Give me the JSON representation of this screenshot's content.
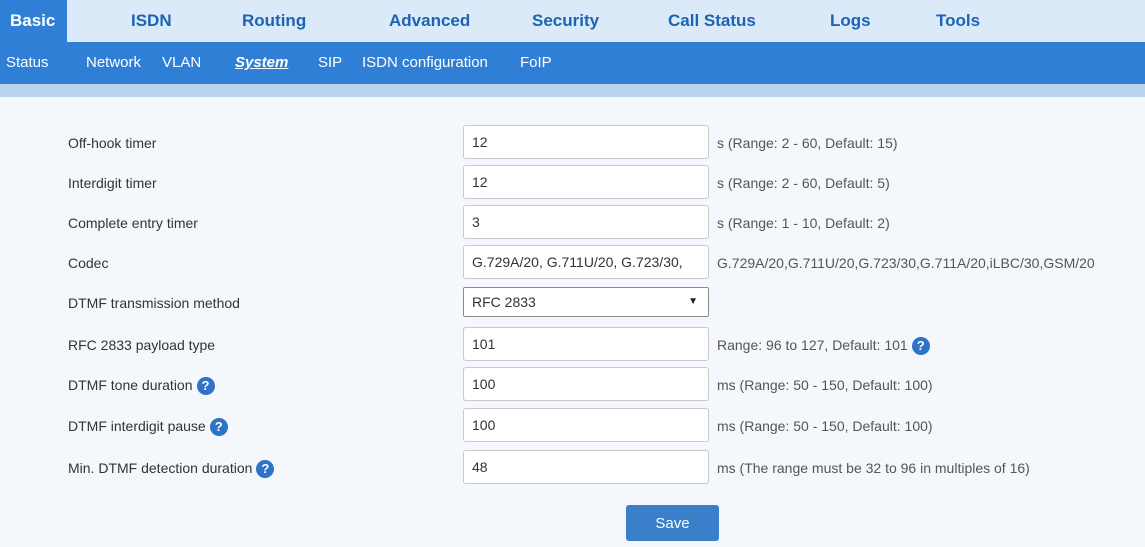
{
  "top_tabs": [
    "Basic",
    "ISDN",
    "Routing",
    "Advanced",
    "Security",
    "Call Status",
    "Logs",
    "Tools"
  ],
  "sub_tabs": [
    "Status",
    "Network",
    "VLAN",
    "System",
    "SIP",
    "ISDN configuration",
    "FoIP"
  ],
  "fields": [
    {
      "label": "Off-hook timer",
      "value": "12",
      "hint": "s (Range: 2 - 60, Default: 15)"
    },
    {
      "label": "Interdigit timer",
      "value": "12",
      "hint": "s (Range: 2 - 60, Default: 5)"
    },
    {
      "label": "Complete entry timer",
      "value": "3",
      "hint": "s (Range: 1 - 10, Default: 2)"
    },
    {
      "label": "Codec",
      "value": "G.729A/20, G.711U/20, G.723/30,",
      "hint": "G.729A/20,G.711U/20,G.723/30,G.711A/20,iLBC/30,GSM/20"
    },
    {
      "label": "DTMF transmission method",
      "value": "RFC 2833",
      "hint": ""
    },
    {
      "label": "RFC 2833 payload type",
      "value": "101",
      "hint": "Range: 96 to 127, Default: 101"
    },
    {
      "label": "DTMF tone duration",
      "value": "100",
      "hint": "ms (Range: 50 - 150, Default: 100)"
    },
    {
      "label": "DTMF interdigit pause",
      "value": "100",
      "hint": "ms (Range: 50 - 150, Default: 100)"
    },
    {
      "label": "Min. DTMF detection duration",
      "value": "48",
      "hint": "ms (The range must be 32 to 96 in multiples of 16)"
    }
  ],
  "help_icon_glyph": "?",
  "save_label": "Save",
  "colors": {
    "accent": "#2f7fd6",
    "nav_bg": "#daeaf8",
    "nav_text": "#1d63b5",
    "help": "#2f73c6"
  }
}
